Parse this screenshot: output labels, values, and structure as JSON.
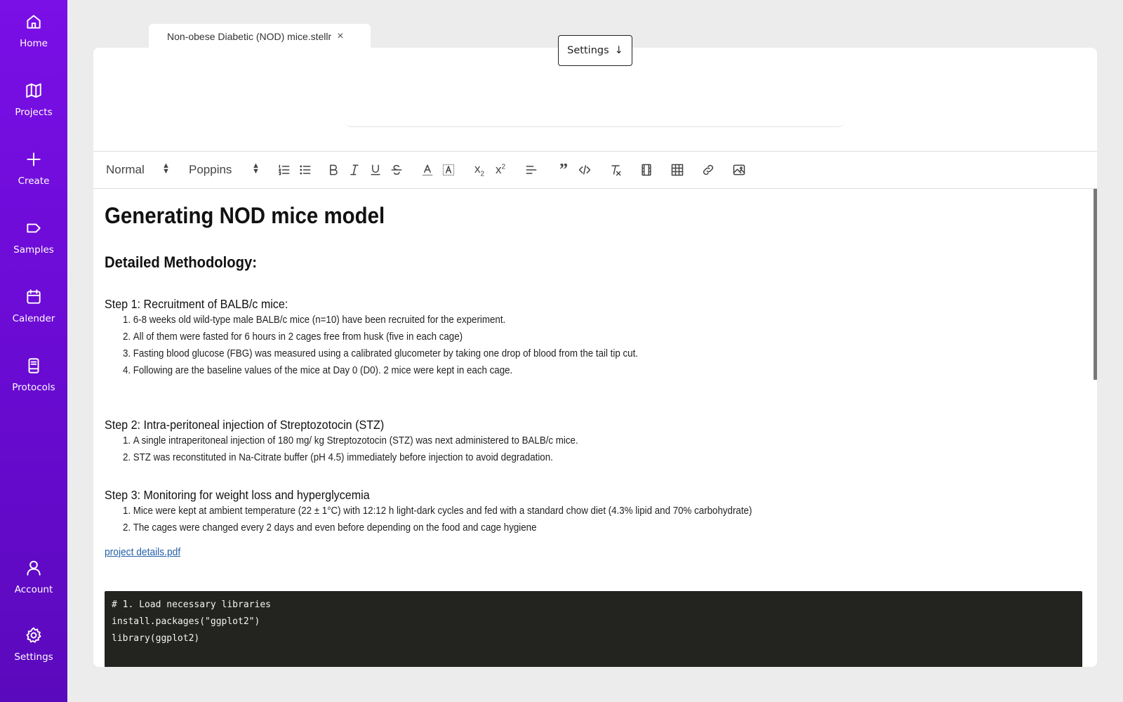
{
  "sidebar": {
    "items": [
      {
        "label": "Home",
        "icon": "home-icon"
      },
      {
        "label": "Projects",
        "icon": "map-icon"
      },
      {
        "label": "Create",
        "icon": "plus-icon"
      },
      {
        "label": "Samples",
        "icon": "tag-icon"
      },
      {
        "label": "Calender",
        "icon": "calendar-icon"
      },
      {
        "label": "Protocols",
        "icon": "book-icon"
      },
      {
        "label": "Account",
        "icon": "user-icon"
      },
      {
        "label": "Settings",
        "icon": "gear-icon"
      }
    ],
    "gradient_top": "#7a0fe6",
    "gradient_bottom": "#5b09bd"
  },
  "tab": {
    "title": "Non-obese Diabetic (NOD) mice.stellr",
    "close": "×"
  },
  "settings_button": {
    "label": "Settings",
    "arrow": "↓"
  },
  "toolbar": {
    "paragraph_style": "Normal",
    "font": "Poppins",
    "buttons": [
      "ordered-list",
      "bullet-list",
      "bold",
      "italic",
      "underline",
      "strikethrough",
      "font-color",
      "background-color",
      "subscript",
      "superscript",
      "align",
      "blockquote",
      "code",
      "clear-format",
      "video",
      "table",
      "link",
      "image"
    ]
  },
  "document": {
    "title": "Generating NOD mice model",
    "subtitle": "Detailed Methodology:",
    "steps": [
      {
        "heading": "Step 1: Recruitment of BALB/c mice:",
        "items": [
          "6-8 weeks old wild-type male BALB/c mice (n=10) have been recruited for the experiment.",
          "All of them were fasted for 6 hours in 2 cages free from husk (five in each cage)",
          "Fasting blood glucose (FBG) was measured using a calibrated glucometer by taking one drop of blood from the tail tip cut.",
          "Following are the baseline values of the mice at Day 0 (D0). 2 mice were kept in each cage."
        ]
      },
      {
        "heading": "Step 2: Intra-peritoneal injection of Streptozotocin (STZ)",
        "items": [
          "A single intraperitoneal injection of 180 mg/ kg Streptozotocin (STZ) was next administered to BALB/c mice.",
          "STZ was reconstituted in Na-Citrate buffer (pH 4.5) immediately before injection to avoid degradation."
        ]
      },
      {
        "heading": "Step 3: Monitoring for weight loss and hyperglycemia",
        "items": [
          "Mice were kept at ambient temperature (22 ± 1°C) with 12:12 h light-dark cycles and fed with a standard chow diet (4.3% lipid and 70% carbohydrate)",
          "The cages were changed every 2 days and even before depending on the food and cage hygiene"
        ]
      }
    ],
    "attachment": "project details.pdf",
    "code_lines": [
      "# 1. Load necessary libraries",
      "install.packages(\"ggplot2\")",
      "library(ggplot2)"
    ]
  }
}
